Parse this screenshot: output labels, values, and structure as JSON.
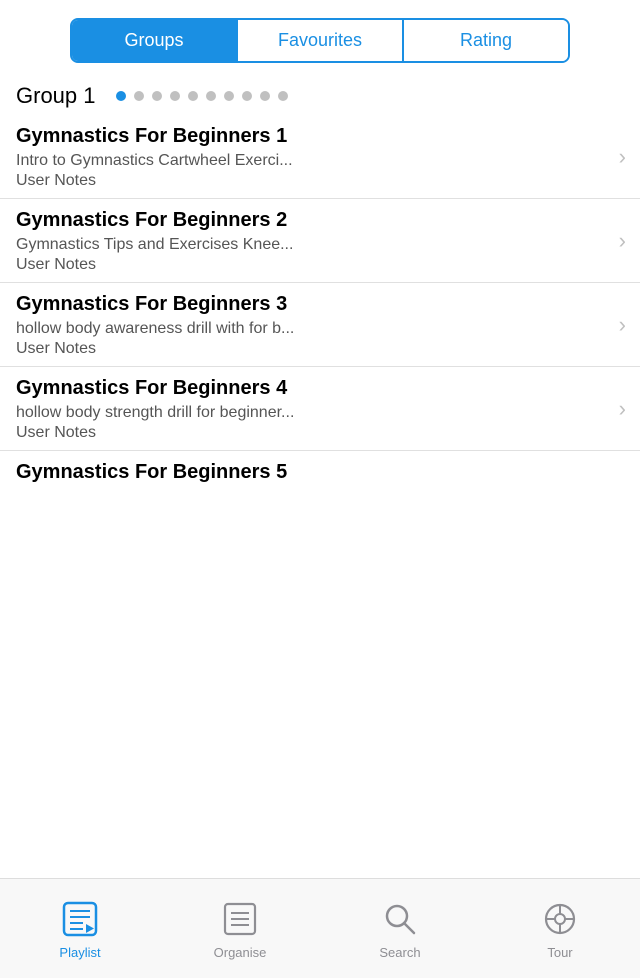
{
  "segmented": {
    "buttons": [
      {
        "label": "Groups",
        "active": true
      },
      {
        "label": "Favourites",
        "active": false
      },
      {
        "label": "Rating",
        "active": false
      }
    ]
  },
  "group": {
    "title": "Group 1",
    "dots": 10,
    "active_dot": 0
  },
  "list": [
    {
      "title": "Gymnastics For Beginners 1",
      "subtitle": "Intro to Gymnastics  Cartwheel Exerci...",
      "notes": "User Notes"
    },
    {
      "title": "Gymnastics For Beginners 2",
      "subtitle": "Gymnastics Tips and Exercises  Knee...",
      "notes": "User Notes"
    },
    {
      "title": "Gymnastics For Beginners 3",
      "subtitle": "hollow body awareness drill with for b...",
      "notes": "User Notes"
    },
    {
      "title": "Gymnastics For Beginners 4",
      "subtitle": "hollow body strength drill for beginner...",
      "notes": "User Notes"
    },
    {
      "title": "Gymnastics For Beginners 5",
      "subtitle": "",
      "notes": ""
    }
  ],
  "tabs": [
    {
      "label": "Playlist",
      "active": true
    },
    {
      "label": "Organise",
      "active": false
    },
    {
      "label": "Search",
      "active": false
    },
    {
      "label": "Tour",
      "active": false
    }
  ]
}
